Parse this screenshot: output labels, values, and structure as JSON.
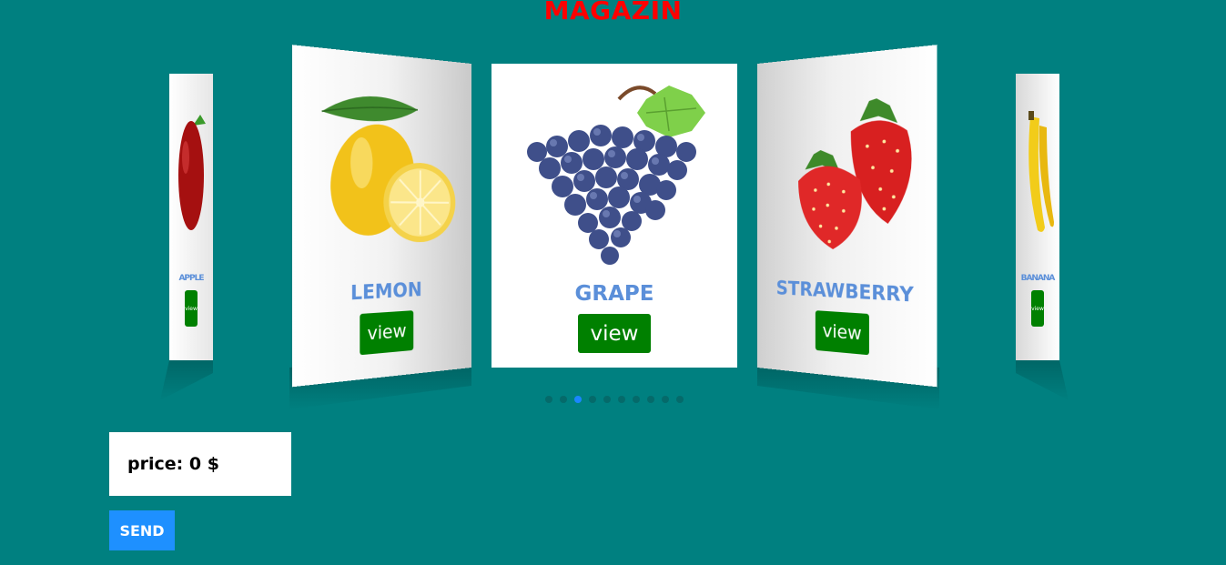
{
  "page": {
    "title": "MAGAZIN"
  },
  "carousel": {
    "cards": [
      {
        "id": "apple",
        "name": "APPLE",
        "button": "view"
      },
      {
        "id": "lemon",
        "name": "LEMON",
        "button": "view"
      },
      {
        "id": "grape",
        "name": "GRAPE",
        "button": "view"
      },
      {
        "id": "strawberry",
        "name": "STRAWBERRY",
        "button": "view"
      },
      {
        "id": "banana",
        "name": "BANANA",
        "button": "view"
      }
    ],
    "dot_count": 10,
    "active_dot": 2
  },
  "price": {
    "label": "price:",
    "value": "0",
    "currency": "$"
  },
  "send_button": {
    "label": "SEND"
  },
  "colors": {
    "background": "#008080",
    "title": "#ff0000",
    "view_button": "#008000",
    "send_button": "#1e90ff",
    "fruit_name": "#5b8fd9",
    "active_dot": "#1a86ff"
  }
}
